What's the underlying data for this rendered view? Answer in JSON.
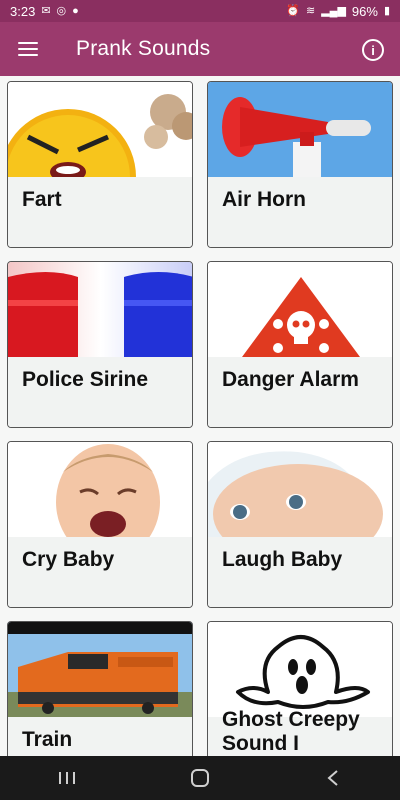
{
  "status_bar": {
    "time": "3:23",
    "battery": "96%"
  },
  "app_bar": {
    "title": "Prank Sounds",
    "menu_icon": "hamburger-menu-icon",
    "info_icon": "info-icon",
    "background_color": "#9b3a6d"
  },
  "sounds": [
    {
      "label": "Fart",
      "image": "angry-emoji-fart-image"
    },
    {
      "label": "Air Horn",
      "image": "red-air-horn-image"
    },
    {
      "label": "Police Sirine",
      "image": "police-siren-lights-image"
    },
    {
      "label": "Danger Alarm",
      "image": "danger-skull-warning-image"
    },
    {
      "label": "Cry Baby",
      "image": "crying-baby-image"
    },
    {
      "label": "Laugh Baby",
      "image": "smiling-baby-image"
    },
    {
      "label": "Train",
      "image": "orange-locomotive-image"
    },
    {
      "label": "Ghost Creepy Sound I",
      "image": "ghost-icon-image"
    }
  ],
  "nav_bar": {
    "recents_icon": "recents-icon",
    "home_icon": "home-icon",
    "back_icon": "back-icon"
  }
}
